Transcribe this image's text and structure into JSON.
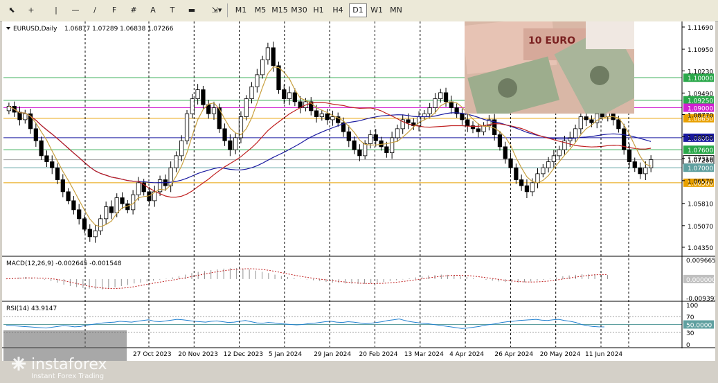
{
  "toolbar": {
    "tools": [
      {
        "name": "cursor-tool",
        "glyph": "⬉"
      },
      {
        "name": "crosshair-tool",
        "glyph": "+"
      },
      {
        "name": "vertical-line-tool",
        "glyph": "|"
      },
      {
        "name": "horizontal-line-tool",
        "glyph": "—"
      },
      {
        "name": "trend-line-tool",
        "glyph": "/"
      },
      {
        "name": "fibonacci-tool",
        "glyph": "F"
      },
      {
        "name": "fibo-grid-tool",
        "glyph": "#"
      },
      {
        "name": "text-tool",
        "glyph": "A"
      },
      {
        "name": "text-label-tool",
        "glyph": "T"
      },
      {
        "name": "rectangle-tool",
        "glyph": "▬"
      },
      {
        "name": "shapes-tool",
        "glyph": "⇲▾"
      }
    ],
    "timeframes": [
      "M1",
      "M5",
      "M15",
      "M30",
      "H1",
      "H4",
      "D1",
      "W1",
      "MN"
    ],
    "active_timeframe": "D1"
  },
  "header": {
    "symbol": "EURUSD,Daily",
    "ohlc": "1.06877 1.07289 1.06838 1.07266"
  },
  "chart_data": [
    {
      "type": "candlestick",
      "title": "EURUSD,Daily",
      "y_axis_ticks": [
        "1.11690",
        "1.10950",
        "1.10230",
        "1.09490",
        "1.08770",
        "1.08030",
        "1.07310",
        "1.06570",
        "1.05810",
        "1.05070",
        "1.04350"
      ],
      "ylim": [
        1.0435,
        1.1169
      ],
      "x_axis_ticks": [
        "27 Oct 2023",
        "20 Nov 2023",
        "12 Dec 2023",
        "5 Jan 2024",
        "29 Jan 2024",
        "20 Feb 2024",
        "13 Mar 2024",
        "4 Apr 2024",
        "26 Apr 2024",
        "20 May 2024",
        "11 Jun 2024"
      ],
      "close_series_approx": [
        1.0905,
        1.0885,
        1.086,
        1.088,
        1.083,
        1.079,
        1.074,
        1.072,
        1.07,
        1.066,
        1.062,
        1.059,
        1.056,
        1.053,
        1.0495,
        1.047,
        1.049,
        1.053,
        1.057,
        1.055,
        1.06,
        1.058,
        1.056,
        1.061,
        1.065,
        1.062,
        1.059,
        1.062,
        1.066,
        1.064,
        1.07,
        1.074,
        1.079,
        1.088,
        1.093,
        1.096,
        1.091,
        1.088,
        1.09,
        1.083,
        1.079,
        1.076,
        1.08,
        1.087,
        1.093,
        1.097,
        1.101,
        1.106,
        1.11,
        1.104,
        1.096,
        1.093,
        1.095,
        1.092,
        1.09,
        1.092,
        1.089,
        1.087,
        1.088,
        1.086,
        1.087,
        1.085,
        1.082,
        1.079,
        1.076,
        1.074,
        1.078,
        1.081,
        1.079,
        1.077,
        1.075,
        1.08,
        1.083,
        1.086,
        1.085,
        1.084,
        1.087,
        1.088,
        1.09,
        1.093,
        1.095,
        1.092,
        1.09,
        1.088,
        1.086,
        1.084,
        1.083,
        1.082,
        1.084,
        1.086,
        1.081,
        1.077,
        1.073,
        1.07,
        1.066,
        1.064,
        1.062,
        1.065,
        1.068,
        1.07,
        1.072,
        1.074,
        1.076,
        1.079,
        1.08,
        1.083,
        1.087,
        1.086,
        1.085,
        1.088,
        1.087,
        1.089,
        1.086,
        1.083,
        1.076,
        1.072,
        1.07,
        1.068,
        1.07,
        1.0727
      ],
      "price_labels": [
        {
          "text": "1.10000",
          "price": 1.1,
          "color": "#2aa84a"
        },
        {
          "text": "1.09250",
          "price": 1.0925,
          "color": "#2aa84a"
        },
        {
          "text": "1.09000",
          "price": 1.09,
          "color": "#d020d0"
        },
        {
          "text": "1.08650",
          "price": 1.0865,
          "color": "#e8a000"
        },
        {
          "text": "1.08000",
          "price": 1.08,
          "color": "#1a1aa0"
        },
        {
          "text": "1.07600",
          "price": 1.076,
          "color": "#2aa84a"
        },
        {
          "text": "1.07266",
          "price": 1.07266,
          "color": "#ffffff"
        },
        {
          "text": "1.07000",
          "price": 1.07,
          "color": "#5fa0a0"
        },
        {
          "text": "1.06500",
          "price": 1.065,
          "color": "#e8a000"
        }
      ],
      "moving_averages": [
        {
          "color": "#1a1aa0"
        },
        {
          "color": "#c02020"
        },
        {
          "color": "#c8a040"
        }
      ]
    },
    {
      "type": "bar",
      "title": "MACD(12,26,9) -0.002645 -0.001548",
      "y_axis_ticks": [
        "0.009665",
        "0.000000",
        "-0.009392"
      ],
      "ylim": [
        -0.009392,
        0.009665
      ],
      "histogram_approx": [
        0.0001,
        0.0004,
        0.0008,
        0.001,
        0.0006,
        0.0002,
        -0.0003,
        -0.001,
        -0.0018,
        -0.0028,
        -0.0035,
        -0.004,
        -0.0045,
        -0.0048,
        -0.005,
        -0.0052,
        -0.0048,
        -0.0042,
        -0.0035,
        -0.003,
        -0.0022,
        -0.0018,
        -0.0012,
        -0.0008,
        -0.0003,
        0.0002,
        0.0008,
        0.0015,
        0.0022,
        0.003,
        0.0036,
        0.004,
        0.0045,
        0.0048,
        0.0052,
        0.0054,
        0.0055,
        0.0052,
        0.0048,
        0.0042,
        0.0036,
        0.003,
        0.0022,
        0.0015,
        0.001,
        0.0005,
        0.0001,
        -0.0002,
        -0.0006,
        -0.001,
        -0.0014,
        -0.0018,
        -0.002,
        -0.0022,
        -0.0023,
        -0.0024,
        -0.0024,
        -0.0022,
        -0.0019,
        -0.0015,
        -0.001,
        -0.0006,
        -0.0002,
        0.0003,
        0.0008,
        0.0013,
        0.0018,
        0.002,
        0.0022,
        0.0021,
        0.0018,
        0.0014,
        0.001,
        0.0004,
        0.0,
        -0.0004,
        -0.0008,
        -0.0012,
        -0.0015,
        -0.0017,
        -0.0018,
        -0.0016,
        -0.0012,
        -0.0008,
        -0.0004,
        0.0002,
        0.0008,
        0.0014,
        0.0018,
        0.0021,
        0.0024,
        0.0025,
        0.0024,
        0.0022,
        0.002,
        0.0016,
        0.0012,
        0.0006,
        0.0,
        -0.0006,
        -0.0012,
        -0.0018,
        -0.0022,
        -0.0025,
        -0.0026
      ]
    },
    {
      "type": "line",
      "title": "RSI(14) 43.9147",
      "y_axis_ticks": [
        "100",
        "70",
        "50.0000",
        "30",
        "0"
      ],
      "ylim": [
        0,
        100
      ],
      "levels": [
        70,
        50,
        30
      ],
      "values_approx": [
        48,
        47,
        46,
        45,
        44,
        43,
        42,
        41,
        43,
        45,
        47,
        46,
        44,
        45,
        48,
        50,
        52,
        54,
        55,
        56,
        58,
        57,
        56,
        58,
        60,
        62,
        58,
        57,
        59,
        61,
        63,
        62,
        60,
        58,
        57,
        56,
        58,
        59,
        57,
        55,
        56,
        58,
        60,
        57,
        54,
        53,
        55,
        54,
        52,
        51,
        50,
        49,
        50,
        52,
        53,
        55,
        57,
        58,
        56,
        55,
        57,
        56,
        54,
        52,
        53,
        55,
        57,
        60,
        62,
        64,
        60,
        57,
        55,
        53,
        52,
        50,
        48,
        46,
        44,
        42,
        40,
        41,
        43,
        45,
        48,
        50,
        52,
        55,
        57,
        58,
        60,
        61,
        62,
        63,
        61,
        60,
        62,
        63,
        60,
        58,
        55,
        50,
        47,
        45,
        44,
        43.9
      ]
    }
  ],
  "brand": {
    "name": "instaforex",
    "tagline": "Instant Forex Trading"
  },
  "photo": {
    "banknote_label": "10 EURO"
  }
}
